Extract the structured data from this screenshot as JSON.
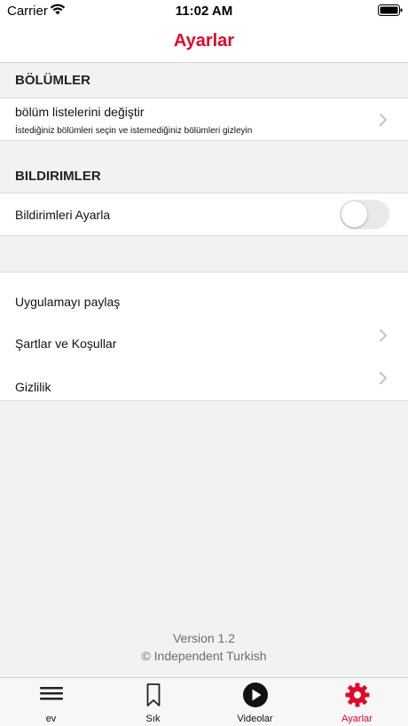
{
  "status_bar": {
    "carrier": "Carrier",
    "time": "11:02 AM"
  },
  "nav": {
    "title": "Ayarlar"
  },
  "sections": {
    "bolumler": {
      "header": "BÖLÜMLER",
      "row_title": "bölüm listelerini değiştir",
      "row_subtitle": "İstediğiniz bölümleri seçin ve istemediğiniz bölümleri gizleyin"
    },
    "bildirimler": {
      "header": "BILDIRIMLER",
      "row_title": "Bildirimleri Ayarla",
      "toggle_on": false
    },
    "other": {
      "share": "Uygulamayı paylaş",
      "terms": "Şartlar ve Koşullar",
      "privacy": "Gizlilik"
    }
  },
  "footer": {
    "version": "Version 1.2",
    "copyright": "© Independent Turkish"
  },
  "tabs": [
    {
      "label": "ev",
      "icon": "menu-icon",
      "active": false
    },
    {
      "label": "Sık",
      "icon": "bookmark-icon",
      "active": false
    },
    {
      "label": "Videolar",
      "icon": "play-icon",
      "active": false
    },
    {
      "label": "Ayarlar",
      "icon": "gear-icon",
      "active": true
    }
  ],
  "colors": {
    "accent": "#e0082b",
    "toggle_off": "#e9e9ea",
    "chevron": "#c4c4c7"
  }
}
